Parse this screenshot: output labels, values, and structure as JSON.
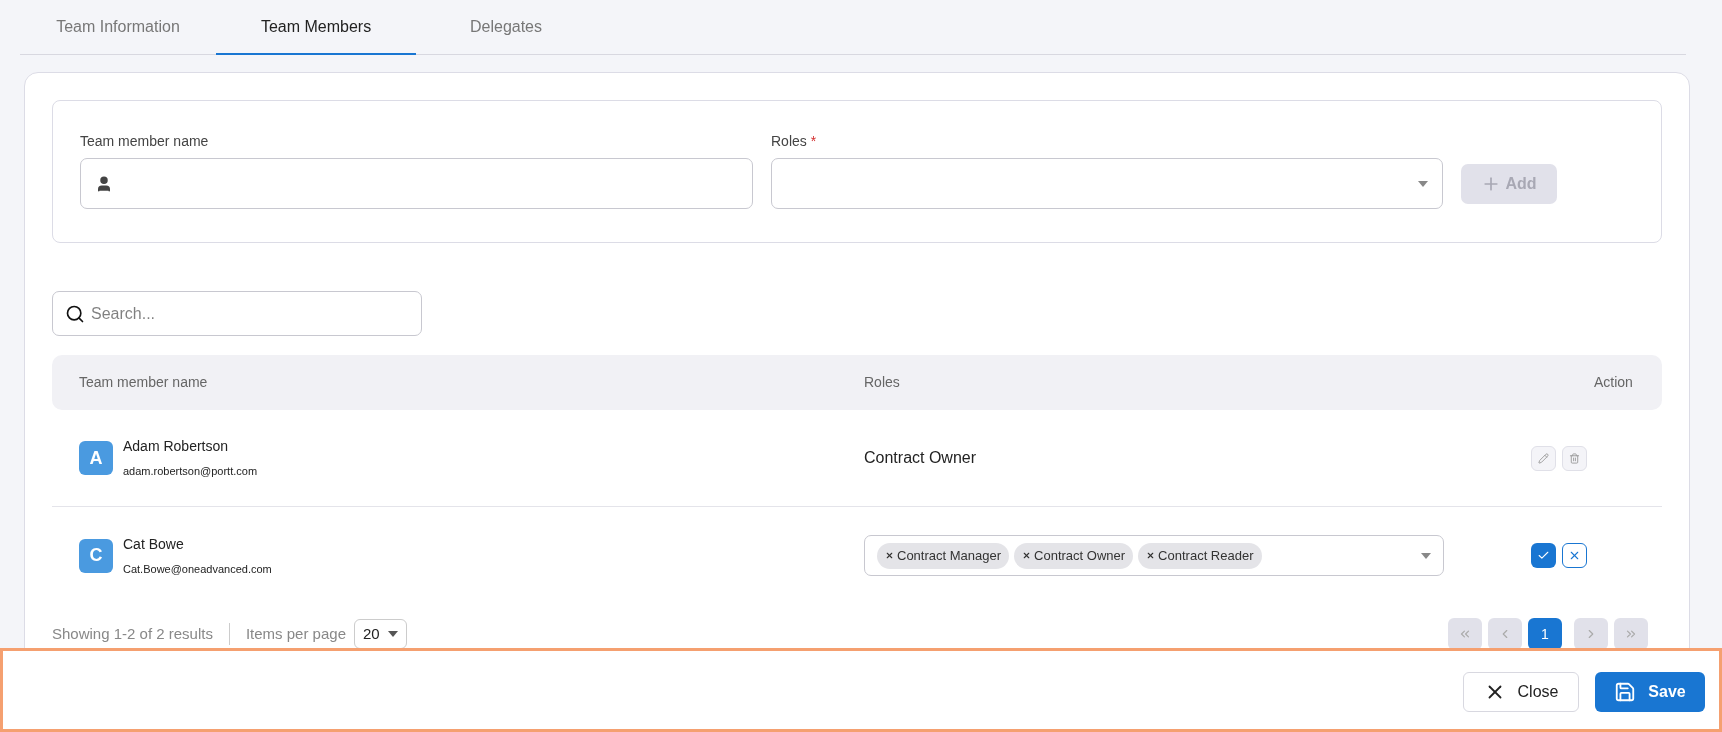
{
  "tabs": [
    {
      "label": "Team Information",
      "selected": false
    },
    {
      "label": "Team Members",
      "selected": true
    },
    {
      "label": "Delegates",
      "selected": false
    }
  ],
  "add_form": {
    "name_label": "Team member name",
    "roles_label": "Roles",
    "roles_required_mark": "*",
    "add_button": {
      "label": "Add",
      "disabled": true
    }
  },
  "search": {
    "placeholder": "Search..."
  },
  "table": {
    "columns": [
      "Team member name",
      "Roles",
      "Action"
    ],
    "rows": [
      {
        "initial": "A",
        "name": "Adam Robertson",
        "email": "adam.robertson@portt.com",
        "editing": false,
        "role_text": "Contract Owner"
      },
      {
        "initial": "C",
        "name": "Cat Bowe",
        "email": "Cat.Bowe@oneadvanced.com",
        "editing": true,
        "role_tags": [
          "Contract Manager",
          "Contract Owner",
          "Contract Reader"
        ]
      }
    ]
  },
  "pagination": {
    "summary": "Showing 1-2 of 2 results",
    "items_per_page_label": "Items per page",
    "items_per_page": "20",
    "pages": [
      {
        "label": "1",
        "selected": true
      }
    ]
  },
  "footer": {
    "close_button": "Close",
    "save_button": "Save"
  }
}
